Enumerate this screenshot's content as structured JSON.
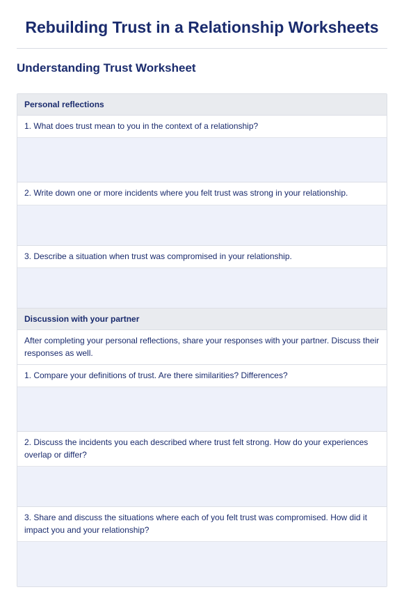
{
  "page": {
    "title": "Rebuilding Trust in a Relationship Worksheets",
    "section_title": "Understanding Trust Worksheet"
  },
  "sections": [
    {
      "header": "Personal reflections",
      "instruction": null,
      "questions": [
        "1. What does trust mean to you in the context of a relationship?",
        "2. Write down one or more incidents where you felt trust was strong in your relationship.",
        "3. Describe a situation when trust was compromised in your relationship."
      ]
    },
    {
      "header": "Discussion with your partner",
      "instruction": "After completing your personal reflections, share your responses with your partner. Discuss their responses as well.",
      "questions": [
        "1. Compare your definitions of trust. Are there similarities? Differences?",
        "2. Discuss the incidents you each described where trust felt strong. How do your experiences overlap or differ?",
        "3. Share and discuss the situations where each of you felt trust was compromised. How did it impact you and your relationship?"
      ]
    }
  ]
}
